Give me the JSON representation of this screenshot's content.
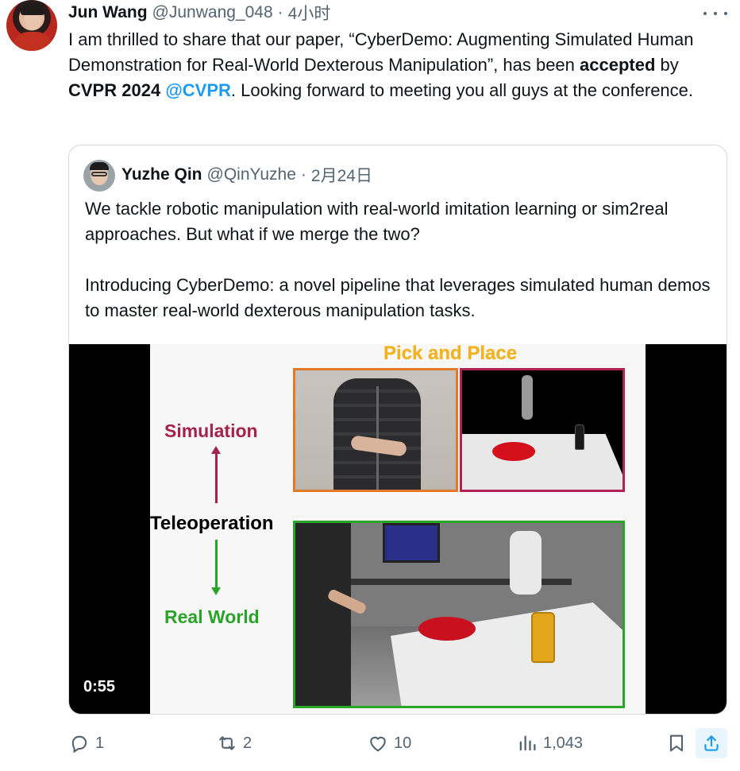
{
  "author": {
    "name": "Jun Wang",
    "handle": "@Junwang_048",
    "separator": "·",
    "time": "4小时"
  },
  "tweet": {
    "part1": "I am thrilled to share that our paper, “CyberDemo: Augmenting Simulated Human Demonstration for Real-World Dexterous Manipulation”, has been ",
    "bold1": "accepted",
    "part2": " by ",
    "bold2": "CVPR 2024",
    "part3": " ",
    "mention": "@CVPR",
    "part4": ". Looking forward to meeting you all guys at the conference."
  },
  "quote": {
    "name": "Yuzhe Qin",
    "handle": "@QinYuzhe",
    "separator": "·",
    "time": "2月24日",
    "paragraph1": "We tackle robotic manipulation with real-world imitation learning or sim2real approaches. But what if we merge the two?",
    "paragraph2": "Introducing CyberDemo: a novel pipeline that leverages simulated human demos to master real-world dexterous manipulation tasks."
  },
  "video": {
    "title": "Pick and Place",
    "label_simulation": "Simulation",
    "label_teleoperation": "Teleoperation",
    "label_real_world": "Real World",
    "duration": "0:55"
  },
  "actions": {
    "replies": "1",
    "retweets": "2",
    "likes": "10",
    "views": "1,043"
  },
  "icons": {
    "reply": "reply-icon",
    "retweet": "retweet-icon",
    "like": "heart-icon",
    "views": "analytics-icon",
    "bookmark": "bookmark-icon",
    "share": "share-icon",
    "more": "more-icon"
  },
  "colors": {
    "link": "#1d9bf0",
    "secondary_text": "#536471",
    "simulation": "#a3214a",
    "real_world": "#2aa428",
    "pick_and_place": "#f0b31f"
  }
}
